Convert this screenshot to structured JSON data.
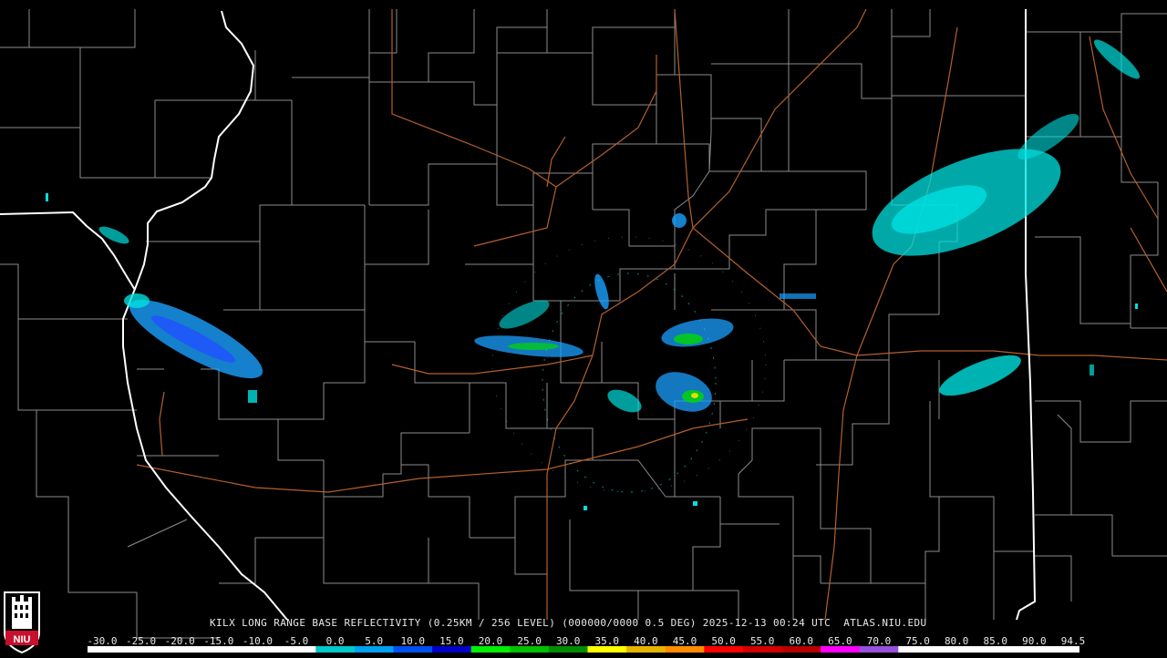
{
  "caption": "KILX LONG RANGE BASE REFLECTIVITY (0.25KM / 256 LEVEL) (000000/0000 0.5 DEG) 2025-12-13 00:24 UTC  ATLAS.NIU.EDU",
  "logo": {
    "text": "NIU",
    "color": "#c8102e"
  },
  "scale": {
    "labels": [
      "-30.0",
      "-25.0",
      "-20.0",
      "-15.0",
      "-10.0",
      "-5.0",
      "0.0",
      "5.0",
      "10.0",
      "15.0",
      "20.0",
      "25.0",
      "30.0",
      "35.0",
      "40.0",
      "45.0",
      "50.0",
      "55.0",
      "60.0",
      "65.0",
      "70.0",
      "75.0",
      "80.0",
      "85.0",
      "90.0",
      "94.5"
    ],
    "colors": [
      "#ffffff",
      "#ffffff",
      "#ffffff",
      "#ffffff",
      "#ffffff",
      "#ffffff",
      "#00c8c8",
      "#00a0f0",
      "#0050f0",
      "#0000c8",
      "#00f000",
      "#00c000",
      "#008c00",
      "#ffff00",
      "#e6b400",
      "#ff8c00",
      "#ff0000",
      "#d20000",
      "#b40000",
      "#ff00ff",
      "#9650dc",
      "#ffffff",
      "#ffffff",
      "#ffffff",
      "#ffffff",
      "#ffffff"
    ]
  },
  "map": {
    "state_border_color": "#ffffff",
    "county_line_color": "#8c8c8c",
    "highway_color": "#b4602c",
    "echo_colors": [
      "#00e0e0",
      "#1aa0ff",
      "#2050ff",
      "#00d800",
      "#e0e000"
    ]
  }
}
